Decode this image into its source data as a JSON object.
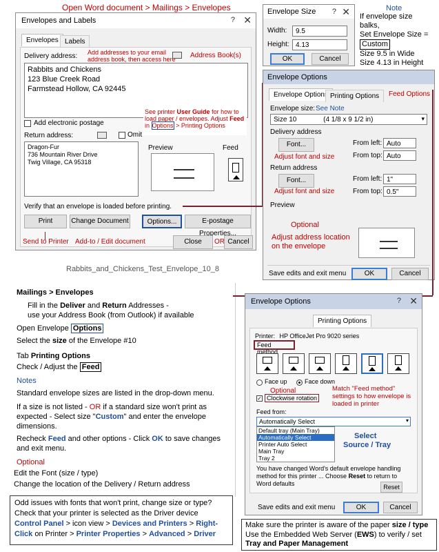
{
  "top_annotation": "Open Word document > Mailings > Envelopes",
  "env_labels": {
    "title": "Envelopes and Labels",
    "help": "?",
    "close_x": "✕",
    "tab_envelopes": "Envelopes",
    "tab_labels": "Labels",
    "delivery_label": "Delivery address:",
    "delivery_note": "Add addresses to your email address book, then access here",
    "address_book": "Address Book(s)",
    "delivery_address": [
      "Rabbits and Chickens",
      "123 Blue Creek Road",
      "Farmstead Hollow, CA 92445"
    ],
    "add_postage": "Add electronic postage",
    "return_label": "Return address:",
    "omit": "Omit",
    "return_address": [
      "Dragon-Fur",
      "736 Mountain River Drive",
      "Twig Village, CA 95318"
    ],
    "printer_note_1": "See printer",
    "printer_note_guide": "User Guide",
    "printer_note_2": "for how to load paper / envelopes.  Adjust",
    "printer_note_feed": "Feed",
    "printer_note_in": "in",
    "printer_note_options": "Options",
    "printer_note_3": "> Printing Options",
    "preview": "Preview",
    "feed": "Feed",
    "verify": "Verify that an envelope is loaded before printing.",
    "print_btn": "Print",
    "change_btn": "Change Document",
    "options_btn": "Options...",
    "epostage_btn": "E-postage Properties...",
    "send_note": "Send to Printer",
    "addto_note": "Add-to / Edit document",
    "close_btn": "Close",
    "or": "OR",
    "cancel_btn": "Cancel",
    "filename": "Rabbits_and_Chickens_Test_Envelope_10_8"
  },
  "env_size": {
    "title": "Envelope Size",
    "help": "?",
    "close_x": "✕",
    "width_label": "Width:",
    "width": "9.5",
    "height_label": "Height:",
    "height": "4.13",
    "ok": "OK",
    "cancel": "Cancel"
  },
  "side_note": {
    "title": "Note",
    "lines": [
      "If envelope size",
      "balks,",
      "Set Envelope Size ="
    ],
    "custom": "Custom",
    "size1": "Size 9.5 in Wide",
    "size2": "Size 4.13 in Height"
  },
  "env_options1": {
    "title": "Envelope Options",
    "tab_env": "Envelope Options",
    "tab_print": "Printing Options",
    "feed_options": "Feed Options",
    "size_label": "Envelope size:",
    "see_note": "See Note",
    "size_value": "Size 10",
    "size_dims": "(4 1/8 x 9 1/2 in)",
    "delivery_addr": "Delivery address",
    "font1": "Font...",
    "from_left": "From left:",
    "auto1": "Auto",
    "from_top": "From top:",
    "auto2": "Auto",
    "adjust1": "Adjust font and size",
    "return_addr": "Return address",
    "font2": "Font...",
    "from_left2": "From left:",
    "left_val": "1\"",
    "from_top2": "From top:",
    "top_val": "0.5\"",
    "adjust2": "Adjust font and size",
    "preview": "Preview",
    "optional": "Optional",
    "adjust_loc": "Adjust address location on the envelope",
    "save_exit": "Save edits and exit menu",
    "ok": "OK",
    "cancel": "Cancel"
  },
  "instructions": {
    "heading": "Mailings",
    "heading2": "> Envelopes",
    "fill1": "Fill in the",
    "fill_deliver": "Deliver",
    "fill_and": "and",
    "fill_return": "Return",
    "fill2": "Addresses -",
    "fill3": "use your Address Book (from Outlook) if available",
    "open_env": "Open Envelope",
    "options": "Options",
    "select1": "Select the",
    "select_size": "size",
    "select2": "of the Envelope #10",
    "tab_label": "Tab",
    "printing_options": "Printing Options",
    "check": "Check / Adjust the",
    "feed": "Feed",
    "notes": "Notes",
    "std1": "Standard envelope sizes are listed in the drop-down menu.",
    "ifsize1": "If a size is not listed -",
    "ifsize_or": "OR",
    "ifsize2": "if a standard size won't print as",
    "ifsize3": "expected - Select size \"",
    "custom": "Custom",
    "ifsize4": "\" and enter the envelope",
    "ifsize5": "dimensions.",
    "recheck1": "Recheck",
    "recheck_feed": "Feed",
    "recheck2": "and other options - Click",
    "recheck_ok": "OK",
    "recheck3": "to save changes",
    "recheck4": "and exit menu.",
    "optional": "Optional",
    "edit_font": "Edit the Font (size / type)",
    "change_loc": "Change the location of the Delivery / Return address"
  },
  "odd_box": {
    "line1": "Odd issues with fonts that won't print, change size or type?",
    "line2": "Check that your printer is selected as the Driver device",
    "cp": "Control Panel",
    "cp2": "> icon view >",
    "dp": "Devices and Printers",
    "cp3": ">",
    "rc": "Right-",
    "rc2": "Click",
    "cp4": "on Printer >",
    "pp": "Printer Properties",
    "cp5": ">",
    "adv": "Advanced",
    "cp6": ">",
    "drv": "Driver"
  },
  "env_options2": {
    "title": "Envelope Options",
    "help": "?",
    "close_x": "✕",
    "tab_print": "Printing Options",
    "printer_label": "Printer:",
    "printer_name": "HP OfficeJet Pro 9020 series",
    "feed_method": "Feed method",
    "face_up": "Face up",
    "face_down": "Face down",
    "optional": "Optional",
    "clockwise": "Clockwise rotation",
    "match_note": "Match \"Feed method\" settings to how envelope is loaded in printer",
    "feed_from": "Feed from:",
    "feed_selected": "Automatically Select",
    "feed_options": [
      "Default tray (Main Tray)",
      "Automatically Select",
      "Printer Auto Select",
      "Main Tray",
      "Tray 2"
    ],
    "select_src": "Select",
    "source_tray": "Source / Tray",
    "changed1": "You have changed Word's default envelope handling",
    "changed2": "method for this printer ...  Choose",
    "reset_word": "Reset",
    "changed3": "to return to",
    "changed4": "Word defaults",
    "reset_btn": "Reset",
    "save_exit": "Save edits and exit menu",
    "ok": "OK",
    "cancel": "Cancel"
  },
  "bottom_note": {
    "line1a": "Make sure the printer is aware of the paper",
    "line1b": "size / type",
    "line2a": "Use the Embedded Web Server (",
    "ews": "EWS",
    "line2b": ") to verify / set",
    "line3": "Tray and Paper Management"
  }
}
